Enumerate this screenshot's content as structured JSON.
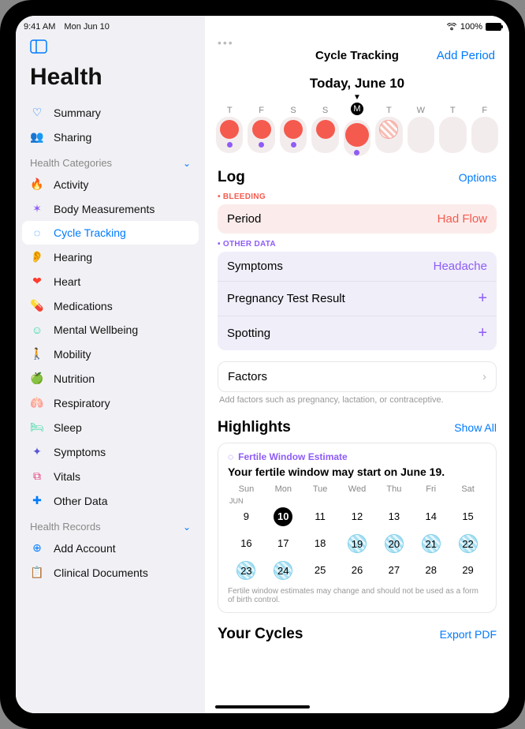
{
  "status": {
    "time": "9:41 AM",
    "date": "Mon Jun 10",
    "battery": "100%"
  },
  "sidebar": {
    "app_title": "Health",
    "top": [
      {
        "label": "Summary"
      },
      {
        "label": "Sharing"
      }
    ],
    "sections": {
      "categories_header": "Health Categories",
      "records_header": "Health Records"
    },
    "categories": [
      {
        "label": "Activity"
      },
      {
        "label": "Body Measurements"
      },
      {
        "label": "Cycle Tracking"
      },
      {
        "label": "Hearing"
      },
      {
        "label": "Heart"
      },
      {
        "label": "Medications"
      },
      {
        "label": "Mental Wellbeing"
      },
      {
        "label": "Mobility"
      },
      {
        "label": "Nutrition"
      },
      {
        "label": "Respiratory"
      },
      {
        "label": "Sleep"
      },
      {
        "label": "Symptoms"
      },
      {
        "label": "Vitals"
      },
      {
        "label": "Other Data"
      }
    ],
    "records": [
      {
        "label": "Add Account"
      },
      {
        "label": "Clinical Documents"
      }
    ]
  },
  "main": {
    "title": "Cycle Tracking",
    "add_period": "Add Period",
    "date_header": "Today, June 10",
    "week": {
      "letters": [
        "T",
        "F",
        "S",
        "S",
        "M",
        "T",
        "W",
        "T",
        "F"
      ],
      "today_index": 4
    },
    "log": {
      "header": "Log",
      "options": "Options",
      "bleeding_header": "BLEEDING",
      "other_header": "OTHER DATA",
      "bleeding": {
        "period_label": "Period",
        "period_value": "Had Flow"
      },
      "other": {
        "symptoms_label": "Symptoms",
        "symptoms_value": "Headache",
        "preg_label": "Pregnancy Test Result",
        "spotting_label": "Spotting"
      },
      "factors_label": "Factors",
      "factors_hint": "Add factors such as pregnancy, lactation, or contraceptive."
    },
    "highlights": {
      "header": "Highlights",
      "show_all": "Show All",
      "tag": "Fertile Window Estimate",
      "title": "Your fertile window may start on June 19.",
      "dow": [
        "Sun",
        "Mon",
        "Tue",
        "Wed",
        "Thu",
        "Fri",
        "Sat"
      ],
      "month": "JUN",
      "grid": [
        [
          "9",
          "10",
          "11",
          "12",
          "13",
          "14",
          "15"
        ],
        [
          "16",
          "17",
          "18",
          "19",
          "20",
          "21",
          "22"
        ],
        [
          "23",
          "24",
          "25",
          "26",
          "27",
          "28",
          "29"
        ]
      ],
      "today": "10",
      "fertile": [
        "19",
        "20",
        "21",
        "22",
        "23",
        "24"
      ],
      "note": "Fertile window estimates may change and should not be used as a form of birth control."
    },
    "your_cycles": "Your Cycles",
    "export_pdf": "Export PDF"
  }
}
